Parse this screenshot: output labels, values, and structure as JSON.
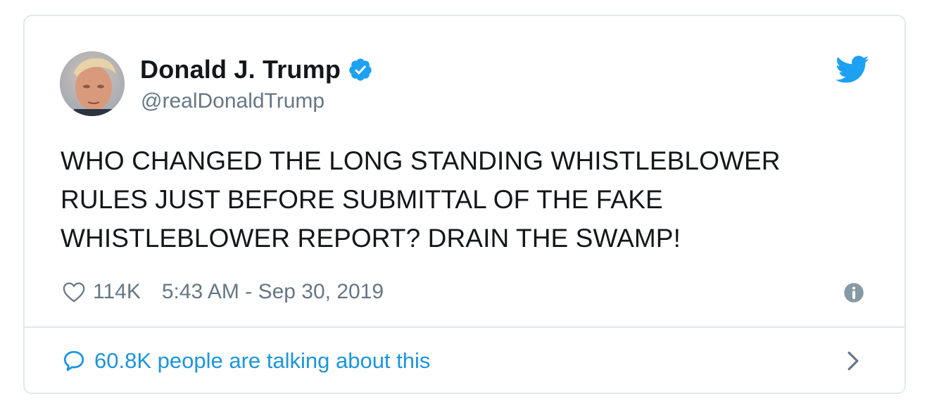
{
  "author": {
    "display_name": "Donald J. Trump",
    "handle": "@realDonaldTrump",
    "verified": true
  },
  "tweet": {
    "lines": [
      "WHO CHANGED THE LONG STANDING WHISTLEBLOWER",
      "RULES JUST BEFORE SUBMITTAL OF THE FAKE",
      "WHISTLEBLOWER REPORT? DRAIN THE SWAMP!"
    ]
  },
  "meta": {
    "like_count": "114K",
    "timestamp": "5:43 AM - Sep 30, 2019"
  },
  "footer": {
    "talking_text": "60.8K people are talking about this"
  },
  "icons": {
    "brand": "twitter-bird-icon",
    "verified": "verified-badge-icon",
    "like": "heart-icon",
    "info": "info-icon",
    "reply": "speech-bubble-icon",
    "next": "chevron-right-icon"
  },
  "colors": {
    "brand_blue": "#1da1f2",
    "link_blue": "#1b95e0",
    "text_primary": "#14171a",
    "text_secondary": "#657786",
    "border": "#e1e8ed"
  }
}
